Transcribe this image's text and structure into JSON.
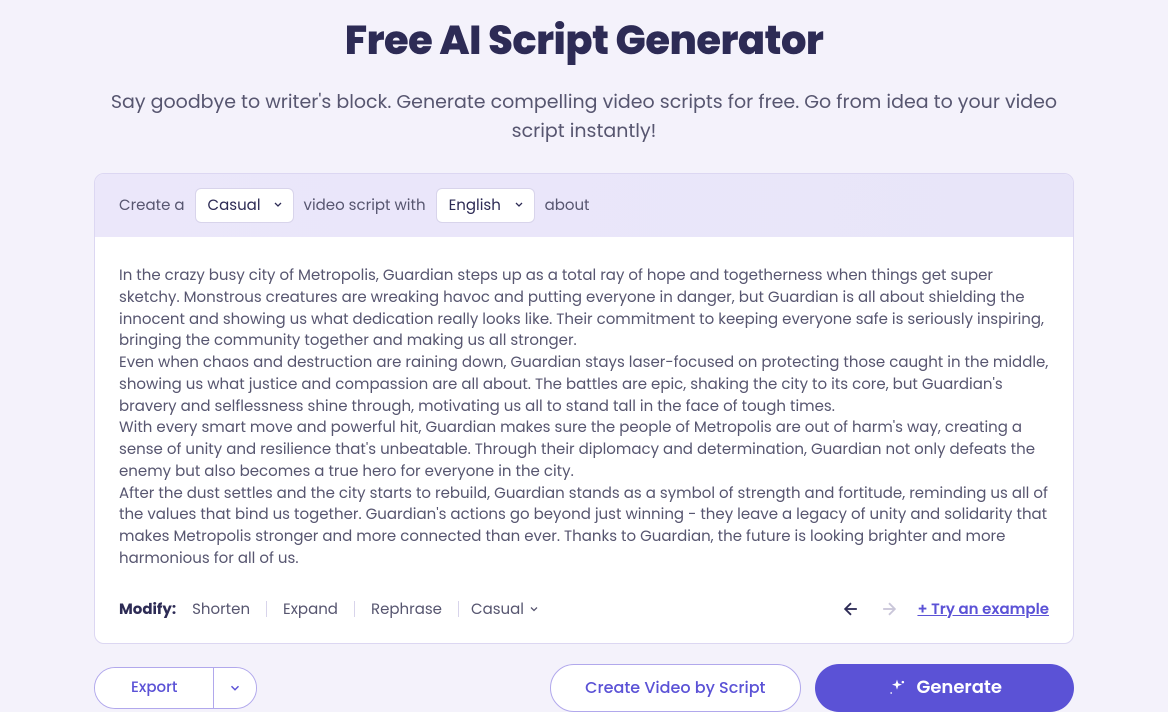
{
  "title": "Free AI Script Generator",
  "subtitle": "Say goodbye to writer's block. Generate compelling video scripts for free. Go from idea to your video script instantly!",
  "header": {
    "create_a": "Create a",
    "tone_value": "Casual",
    "mid_text": "video script with",
    "lang_value": "English",
    "about": "about"
  },
  "script": "In the crazy busy city of Metropolis, Guardian steps up as a total ray of hope and togetherness when things get super sketchy. Monstrous creatures are wreaking havoc and putting everyone in danger, but Guardian is all about shielding the innocent and showing us what dedication really looks like. Their commitment to keeping everyone safe is seriously inspiring, bringing the community together and making us all stronger.\nEven when chaos and destruction are raining down, Guardian stays laser-focused on protecting those caught in the middle, showing us what justice and compassion are all about. The battles are epic, shaking the city to its core, but Guardian's bravery and selflessness shine through, motivating us all to stand tall in the face of tough times.\nWith every smart move and powerful hit, Guardian makes sure the people of Metropolis are out of harm's way, creating a sense of unity and resilience that's unbeatable. Through their diplomacy and determination, Guardian not only defeats the enemy but also becomes a true hero for everyone in the city.\nAfter the dust settles and the city starts to rebuild, Guardian stands as a symbol of strength and fortitude, reminding us all of the values that bind us together. Guardian's actions go beyond just winning - they leave a legacy of unity and solidarity that makes Metropolis stronger and more connected than ever. Thanks to Guardian, the future is looking brighter and more harmonious for all of us.",
  "modify": {
    "label": "Modify:",
    "shorten": "Shorten",
    "expand": "Expand",
    "rephrase": "Rephrase",
    "casual": "Casual"
  },
  "try_example": "+ Try an example",
  "buttons": {
    "export": "Export",
    "create_video": "Create Video by Script",
    "generate": "Generate"
  }
}
